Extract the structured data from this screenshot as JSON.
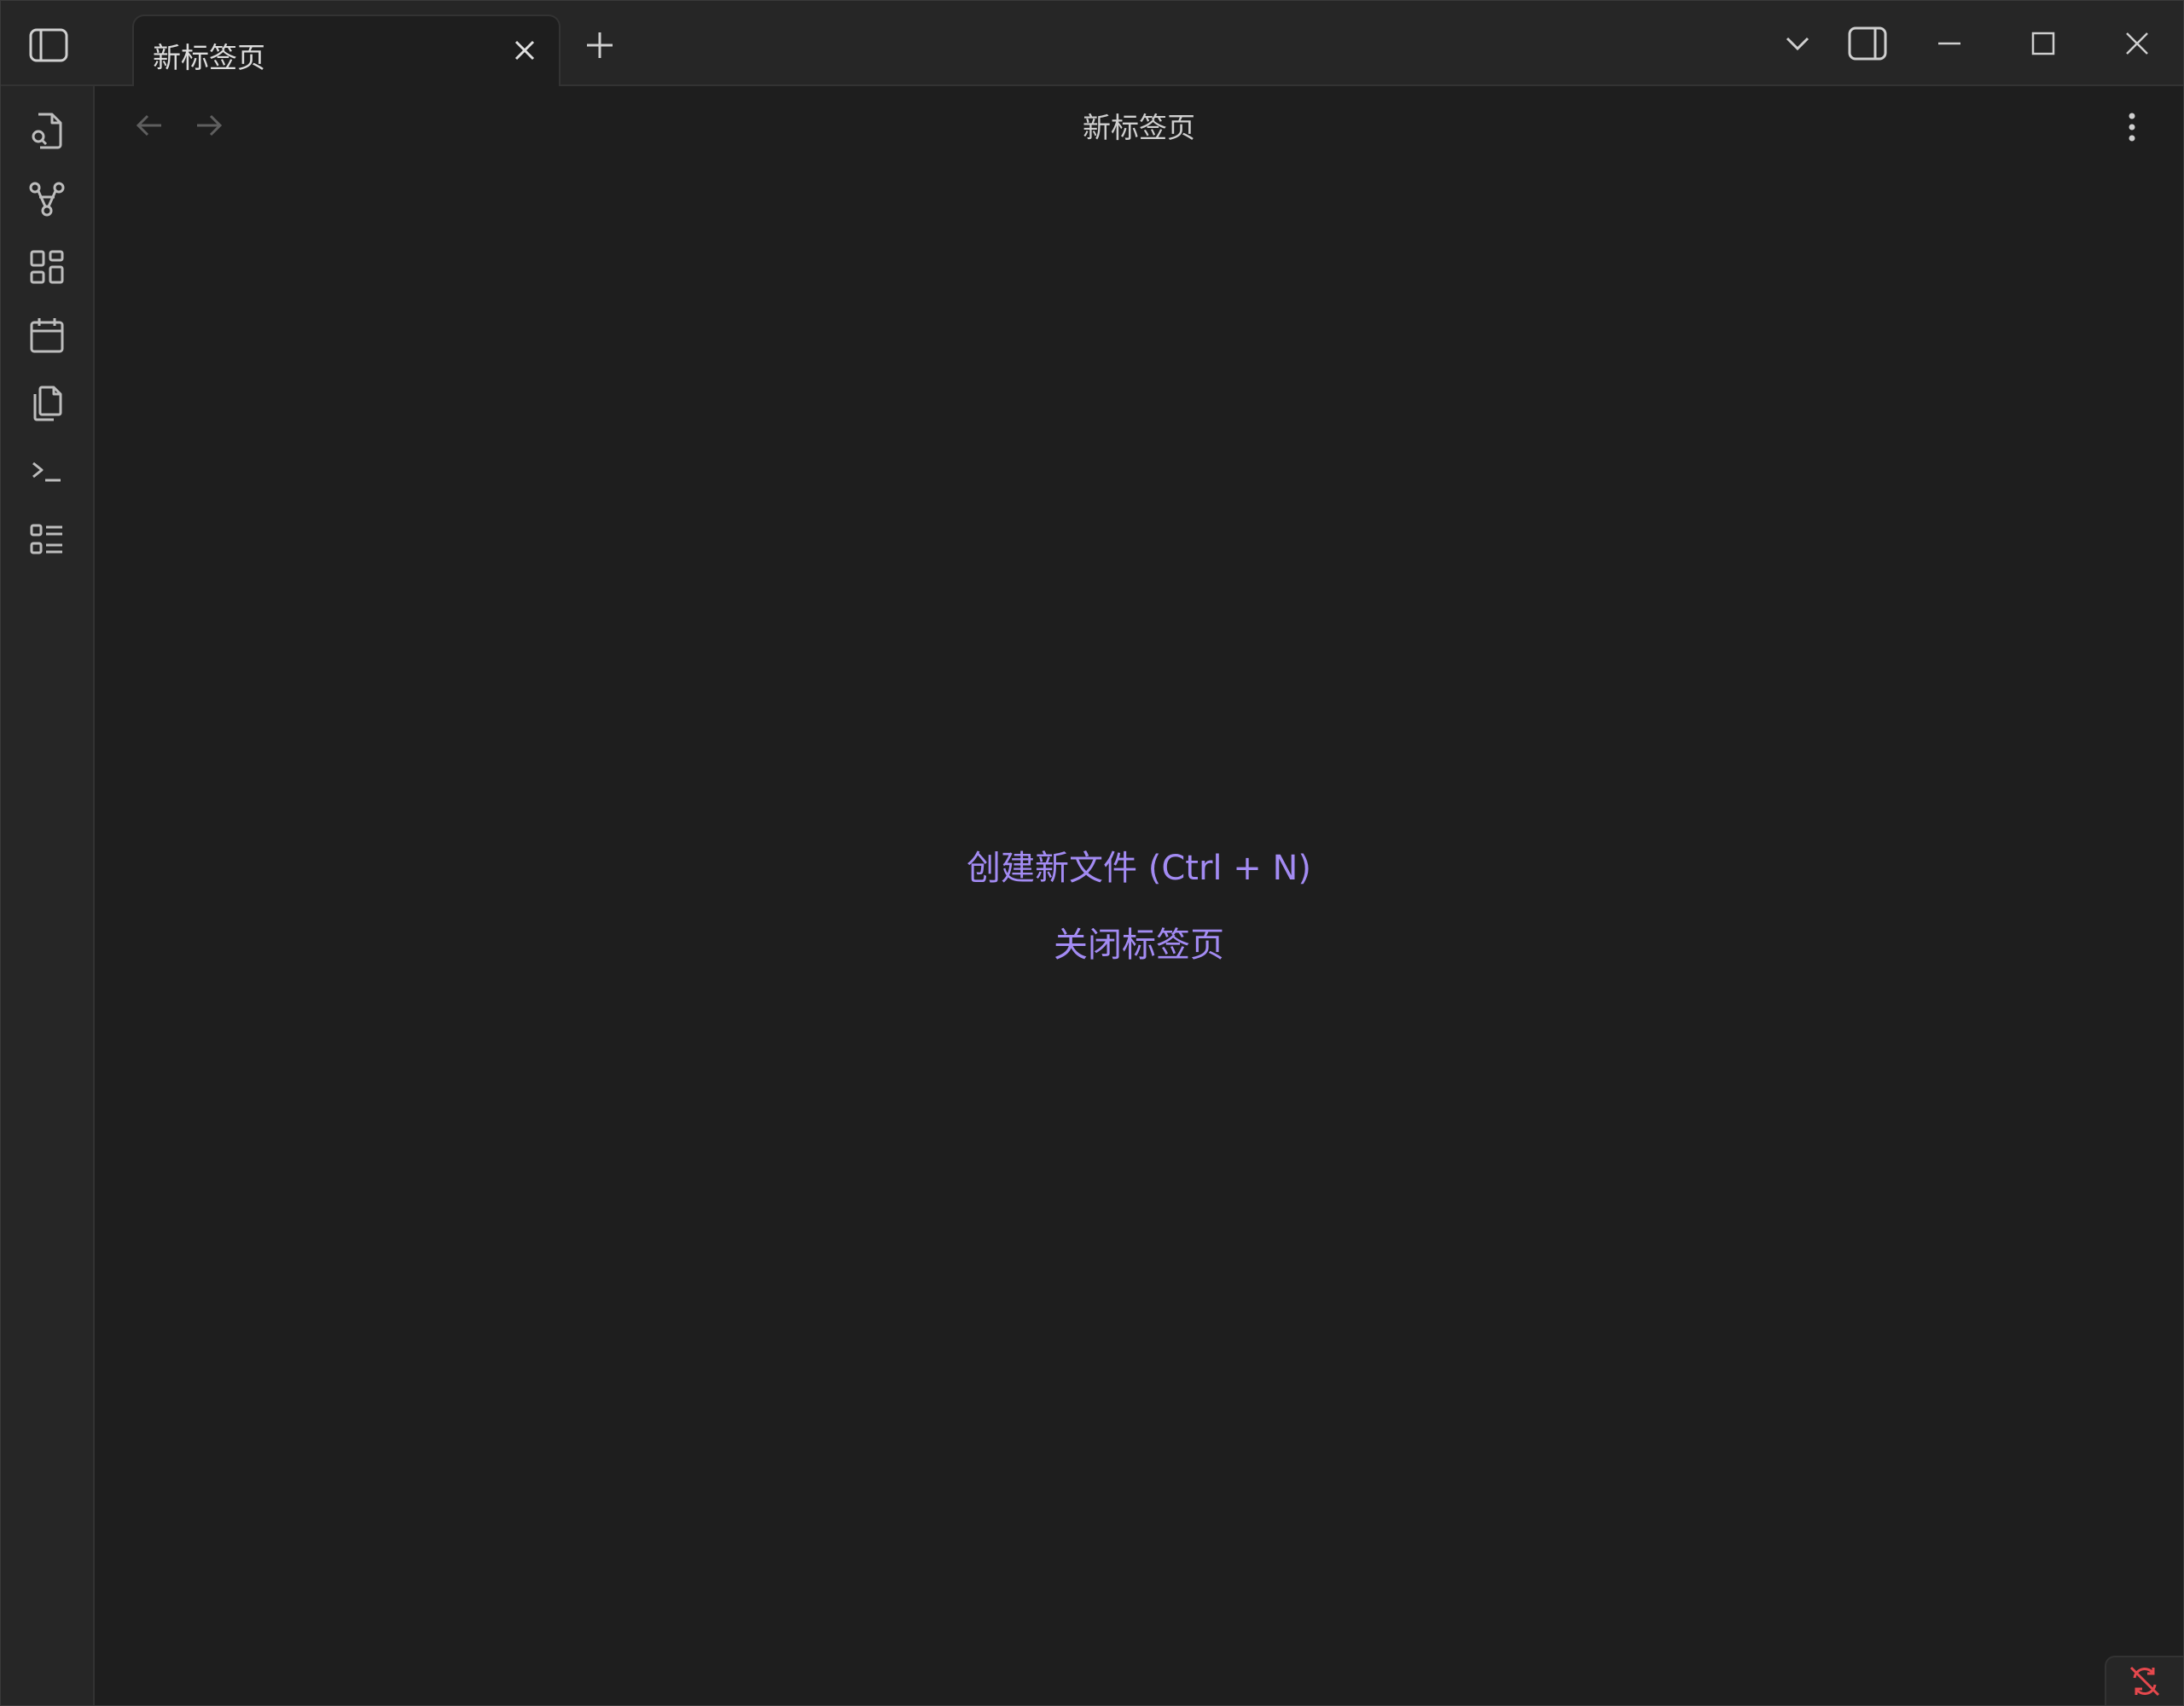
{
  "tab": {
    "title": "新标签页"
  },
  "view": {
    "title": "新标签页"
  },
  "empty_state": {
    "create_new_file": "创建新文件 (Ctrl + N)",
    "close_tab": "关闭标签页"
  },
  "ribbon": {
    "items": [
      {
        "icon": "file-search-icon"
      },
      {
        "icon": "graph-view-icon"
      },
      {
        "icon": "dashboard-icon"
      },
      {
        "icon": "calendar-icon"
      },
      {
        "icon": "copy-files-icon"
      },
      {
        "icon": "terminal-icon"
      },
      {
        "icon": "list-icon"
      }
    ]
  },
  "colors": {
    "accent": "#a38bf3",
    "sync_error": "#e5484d",
    "background": "#1e1e1e",
    "chrome": "#262626"
  }
}
